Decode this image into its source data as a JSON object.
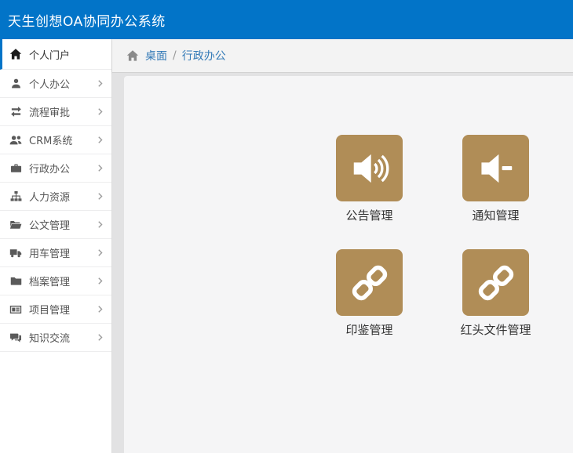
{
  "header": {
    "title": "天生创想OA协同办公系统"
  },
  "sidebar": {
    "items": [
      {
        "label": "个人门户",
        "icon": "home-icon",
        "active": true,
        "chevron": false
      },
      {
        "label": "个人办公",
        "icon": "user-icon",
        "active": false,
        "chevron": true
      },
      {
        "label": "流程审批",
        "icon": "retweet-icon",
        "active": false,
        "chevron": true
      },
      {
        "label": "CRM系统",
        "icon": "users-icon",
        "active": false,
        "chevron": true
      },
      {
        "label": "行政办公",
        "icon": "briefcase-icon",
        "active": false,
        "chevron": true
      },
      {
        "label": "人力资源",
        "icon": "sitemap-icon",
        "active": false,
        "chevron": true
      },
      {
        "label": "公文管理",
        "icon": "folder-open-icon",
        "active": false,
        "chevron": true
      },
      {
        "label": "用车管理",
        "icon": "truck-icon",
        "active": false,
        "chevron": true
      },
      {
        "label": "档案管理",
        "icon": "folder-icon",
        "active": false,
        "chevron": true
      },
      {
        "label": "项目管理",
        "icon": "newspaper-icon",
        "active": false,
        "chevron": true
      },
      {
        "label": "知识交流",
        "icon": "comments-icon",
        "active": false,
        "chevron": true
      }
    ]
  },
  "breadcrumb": {
    "home_icon": "home-icon",
    "separator": "/",
    "items": [
      {
        "label": "桌面"
      },
      {
        "label": "行政办公"
      }
    ]
  },
  "main": {
    "tiles": [
      {
        "label": "公告管理",
        "icon": "volume-up-icon"
      },
      {
        "label": "通知管理",
        "icon": "volume-minus-icon"
      },
      {
        "label": "印鉴管理",
        "icon": "chain-icon"
      },
      {
        "label": "红头文件管理",
        "icon": "chain-icon"
      }
    ]
  },
  "colors": {
    "header_blue": "#0274c8",
    "tile_tan": "#b08d57",
    "link_blue": "#337ab7",
    "active_border_blue": "#0274c8"
  }
}
